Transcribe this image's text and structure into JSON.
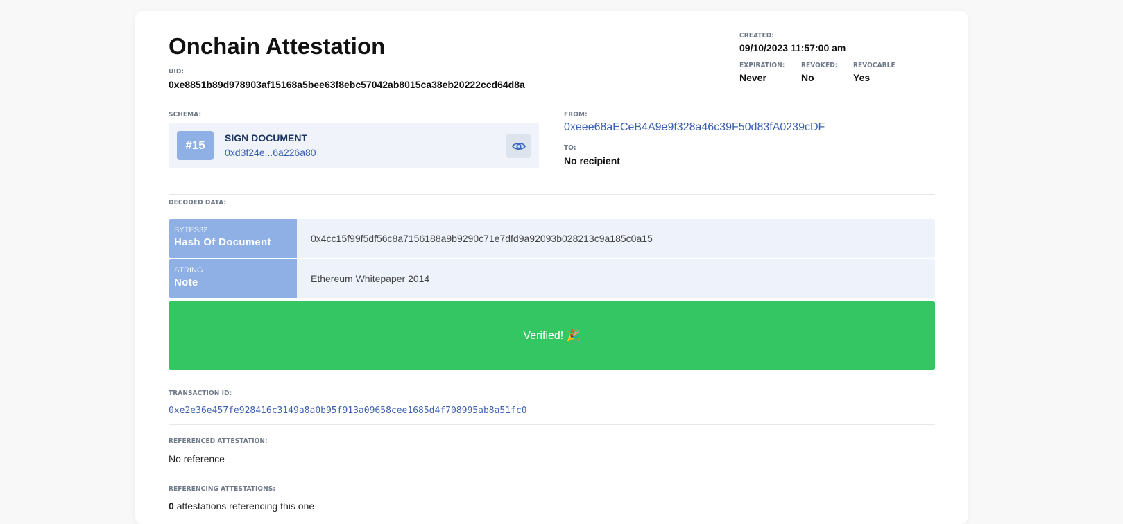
{
  "page": {
    "title": "Onchain Attestation",
    "uid_label": "UID:",
    "uid": "0xe8851b89d978903af15168a5bee63f8ebc57042ab8015ca38eb20222ccd64d8a"
  },
  "meta": {
    "created_label": "CREATED:",
    "created": "09/10/2023 11:57:00 am",
    "expiration_label": "EXPIRATION:",
    "expiration": "Never",
    "revoked_label": "REVOKED:",
    "revoked": "No",
    "revocable_label": "REVOCABLE",
    "revocable": "Yes"
  },
  "schema": {
    "label": "SCHEMA:",
    "number": "#15",
    "name": "SIGN DOCUMENT",
    "address": "0xd3f24e...6a226a80",
    "view_icon": "eye-icon"
  },
  "parties": {
    "from_label": "FROM:",
    "from": "0xeee68aECeB4A9e9f328a46c39F50d83fA0239cDF",
    "to_label": "TO:",
    "to": "No recipient"
  },
  "decoded": {
    "label": "DECODED DATA:",
    "rows": [
      {
        "type": "BYTES32",
        "name": "Hash Of Document",
        "value": "0x4cc15f99f5df56c8a7156188a9b9290c71e7dfd9a92093b028213c9a185c0a15"
      },
      {
        "type": "STRING",
        "name": "Note",
        "value": "Ethereum Whitepaper 2014"
      }
    ]
  },
  "verified": {
    "text": "Verified! 🎉",
    "color": "#34c663"
  },
  "transaction": {
    "label": "TRANSACTION ID:",
    "id": "0xe2e36e457fe928416c3149a8a0b95f913a09658cee1685d4f708995ab8a51fc0"
  },
  "referenced": {
    "label": "REFERENCED ATTESTATION:",
    "value": "No reference"
  },
  "referencing": {
    "label": "REFERENCING ATTESTATIONS:",
    "count": "0",
    "suffix": "attestations referencing this one"
  },
  "colors": {
    "accent": "#8fb0e5",
    "link": "#3a5fb0",
    "row_bg": "#eef3fb"
  }
}
